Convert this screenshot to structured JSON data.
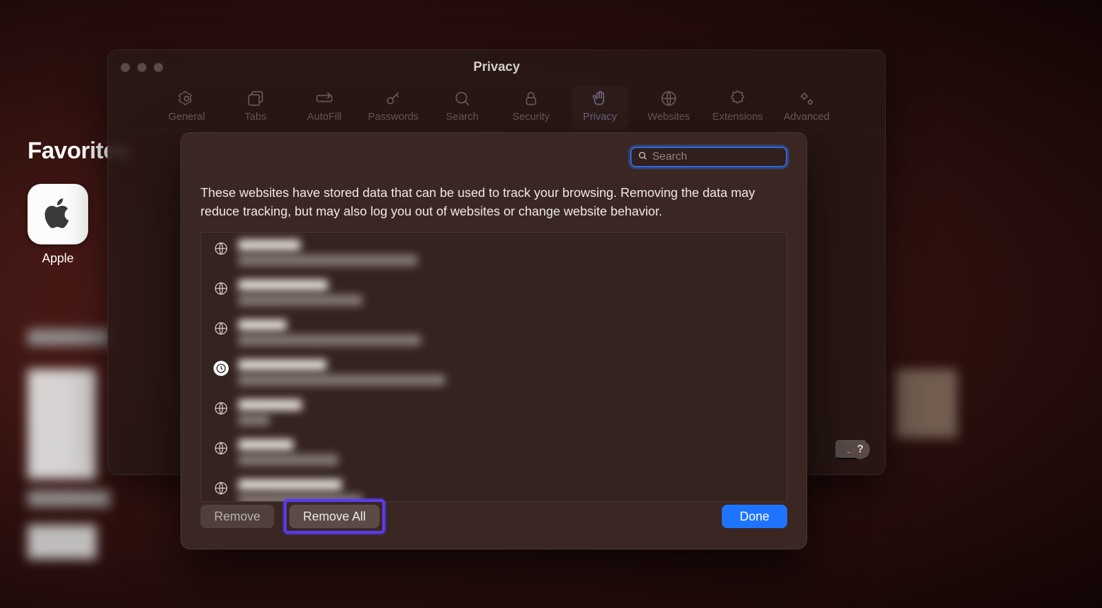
{
  "background": {
    "favorites_heading": "Favorites",
    "apple_label": "Apple"
  },
  "prefs_window": {
    "title": "Privacy",
    "tabs": [
      {
        "label": "General",
        "icon": "gear"
      },
      {
        "label": "Tabs",
        "icon": "tabs"
      },
      {
        "label": "AutoFill",
        "icon": "autofill"
      },
      {
        "label": "Passwords",
        "icon": "key"
      },
      {
        "label": "Search",
        "icon": "search"
      },
      {
        "label": "Security",
        "icon": "lock"
      },
      {
        "label": "Privacy",
        "icon": "hand",
        "active": true
      },
      {
        "label": "Websites",
        "icon": "globe"
      },
      {
        "label": "Extensions",
        "icon": "puzzle"
      },
      {
        "label": "Advanced",
        "icon": "gears"
      }
    ],
    "details_button": "…",
    "help_button": "?"
  },
  "sheet": {
    "search_placeholder": "Search",
    "search_value": "",
    "description": "These websites have stored data that can be used to track your browsing. Removing the data may reduce tracking, but may also log you out of websites or change website behavior.",
    "rows": [
      {
        "icon": "globe"
      },
      {
        "icon": "globe"
      },
      {
        "icon": "globe"
      },
      {
        "icon": "clock"
      },
      {
        "icon": "globe"
      },
      {
        "icon": "globe"
      },
      {
        "icon": "globe"
      }
    ],
    "buttons": {
      "remove": "Remove",
      "remove_all": "Remove All",
      "done": "Done"
    }
  },
  "annotation": {
    "remove_all_highlighted": true
  }
}
